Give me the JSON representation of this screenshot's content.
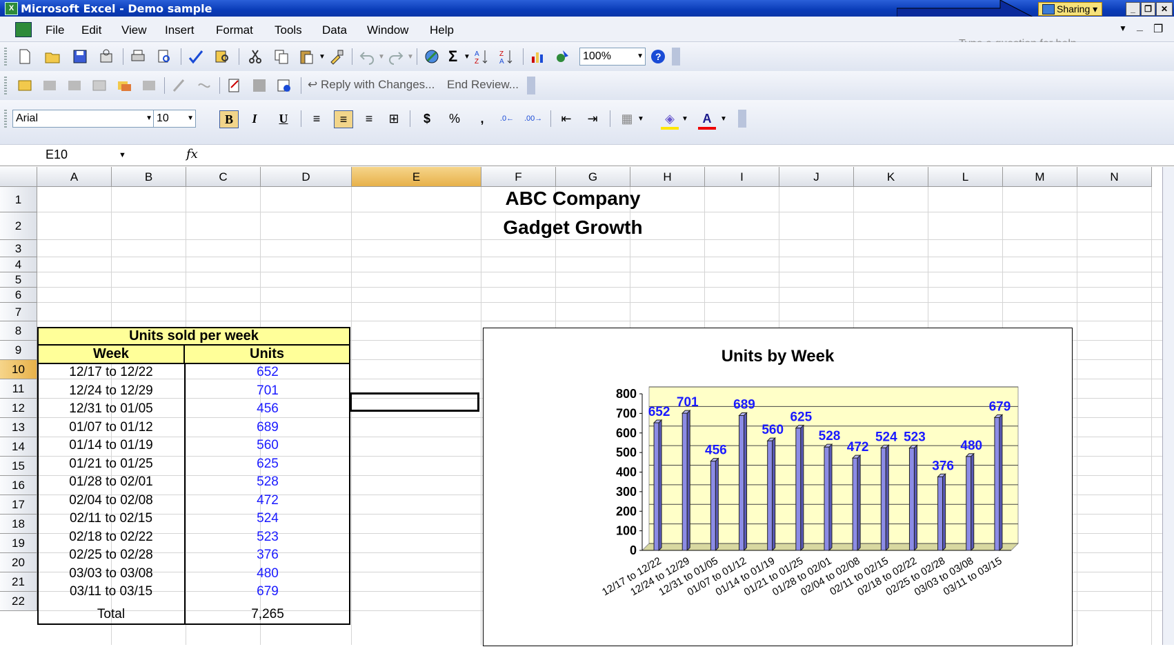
{
  "window": {
    "title": "Microsoft Excel - Demo sample",
    "sharing_label": "Sharing"
  },
  "menu": {
    "items": [
      "File",
      "Edit",
      "View",
      "Insert",
      "Format",
      "Tools",
      "Data",
      "Window",
      "Help"
    ],
    "help_placeholder": "Type a question for help"
  },
  "toolbar": {
    "zoom": "100%",
    "reply_label": "Reply with Changes...",
    "end_review_label": "End Review...",
    "font_name": "Arial",
    "font_size": "10"
  },
  "formula_bar": {
    "name_box": "E10",
    "fx": "fx"
  },
  "grid": {
    "columns": [
      "A",
      "B",
      "C",
      "D",
      "E",
      "F",
      "G",
      "H",
      "I",
      "J",
      "K",
      "L",
      "M",
      "N"
    ],
    "rows": [
      "1",
      "2",
      "3",
      "4",
      "5",
      "6",
      "7",
      "8",
      "9",
      "10",
      "11",
      "12",
      "13",
      "14",
      "15",
      "16",
      "17",
      "18",
      "19",
      "20",
      "21",
      "22"
    ],
    "selected_column": "E",
    "selected_row": "10"
  },
  "sheet": {
    "title1": "ABC Company",
    "title2": "Gadget Growth",
    "table_title": "Units sold per week",
    "col_week": "Week",
    "col_units": "Units",
    "rows": [
      {
        "week": "12/17 to 12/22",
        "units": "652"
      },
      {
        "week": "12/24 to 12/29",
        "units": "701"
      },
      {
        "week": "12/31 to 01/05",
        "units": "456"
      },
      {
        "week": "01/07 to 01/12",
        "units": "689"
      },
      {
        "week": "01/14 to 01/19",
        "units": "560"
      },
      {
        "week": "01/21 to 01/25",
        "units": "625"
      },
      {
        "week": "01/28 to 02/01",
        "units": "528"
      },
      {
        "week": "02/04 to 02/08",
        "units": "472"
      },
      {
        "week": "02/11 to 02/15",
        "units": "524"
      },
      {
        "week": "02/18 to 02/22",
        "units": "523"
      },
      {
        "week": "02/25 to 02/28",
        "units": "376"
      },
      {
        "week": "03/03 to 03/08",
        "units": "480"
      },
      {
        "week": "03/11 to 03/15",
        "units": "679"
      }
    ],
    "total_label": "Total",
    "total_value": "7,265"
  },
  "chart_data": {
    "type": "bar",
    "title": "Units by Week",
    "categories": [
      "12/17 to 12/22",
      "12/24 to 12/29",
      "12/31 to 01/05",
      "01/07 to 01/12",
      "01/14 to 01/19",
      "01/21 to 01/25",
      "01/28 to 02/01",
      "02/04 to 02/08",
      "02/11 to 02/15",
      "02/18 to 02/22",
      "02/25 to 02/28",
      "03/03 to 03/08",
      "03/11 to 03/15"
    ],
    "values": [
      652,
      701,
      456,
      689,
      560,
      625,
      528,
      472,
      524,
      523,
      376,
      480,
      679
    ],
    "ylim": [
      0,
      800
    ],
    "yticks": [
      "0",
      "100",
      "200",
      "300",
      "400",
      "500",
      "600",
      "700",
      "800"
    ],
    "grid": true,
    "legend": "none",
    "colors": {
      "bar": "#8c8ce6",
      "plot_bg": "#ffffc8",
      "label": "#1a1aff"
    }
  },
  "colors": {
    "titlebar": "#0a3cb8",
    "table_header": "#ffff99",
    "units_text": "#1a1aff",
    "arrow": "#0a2a9c"
  }
}
